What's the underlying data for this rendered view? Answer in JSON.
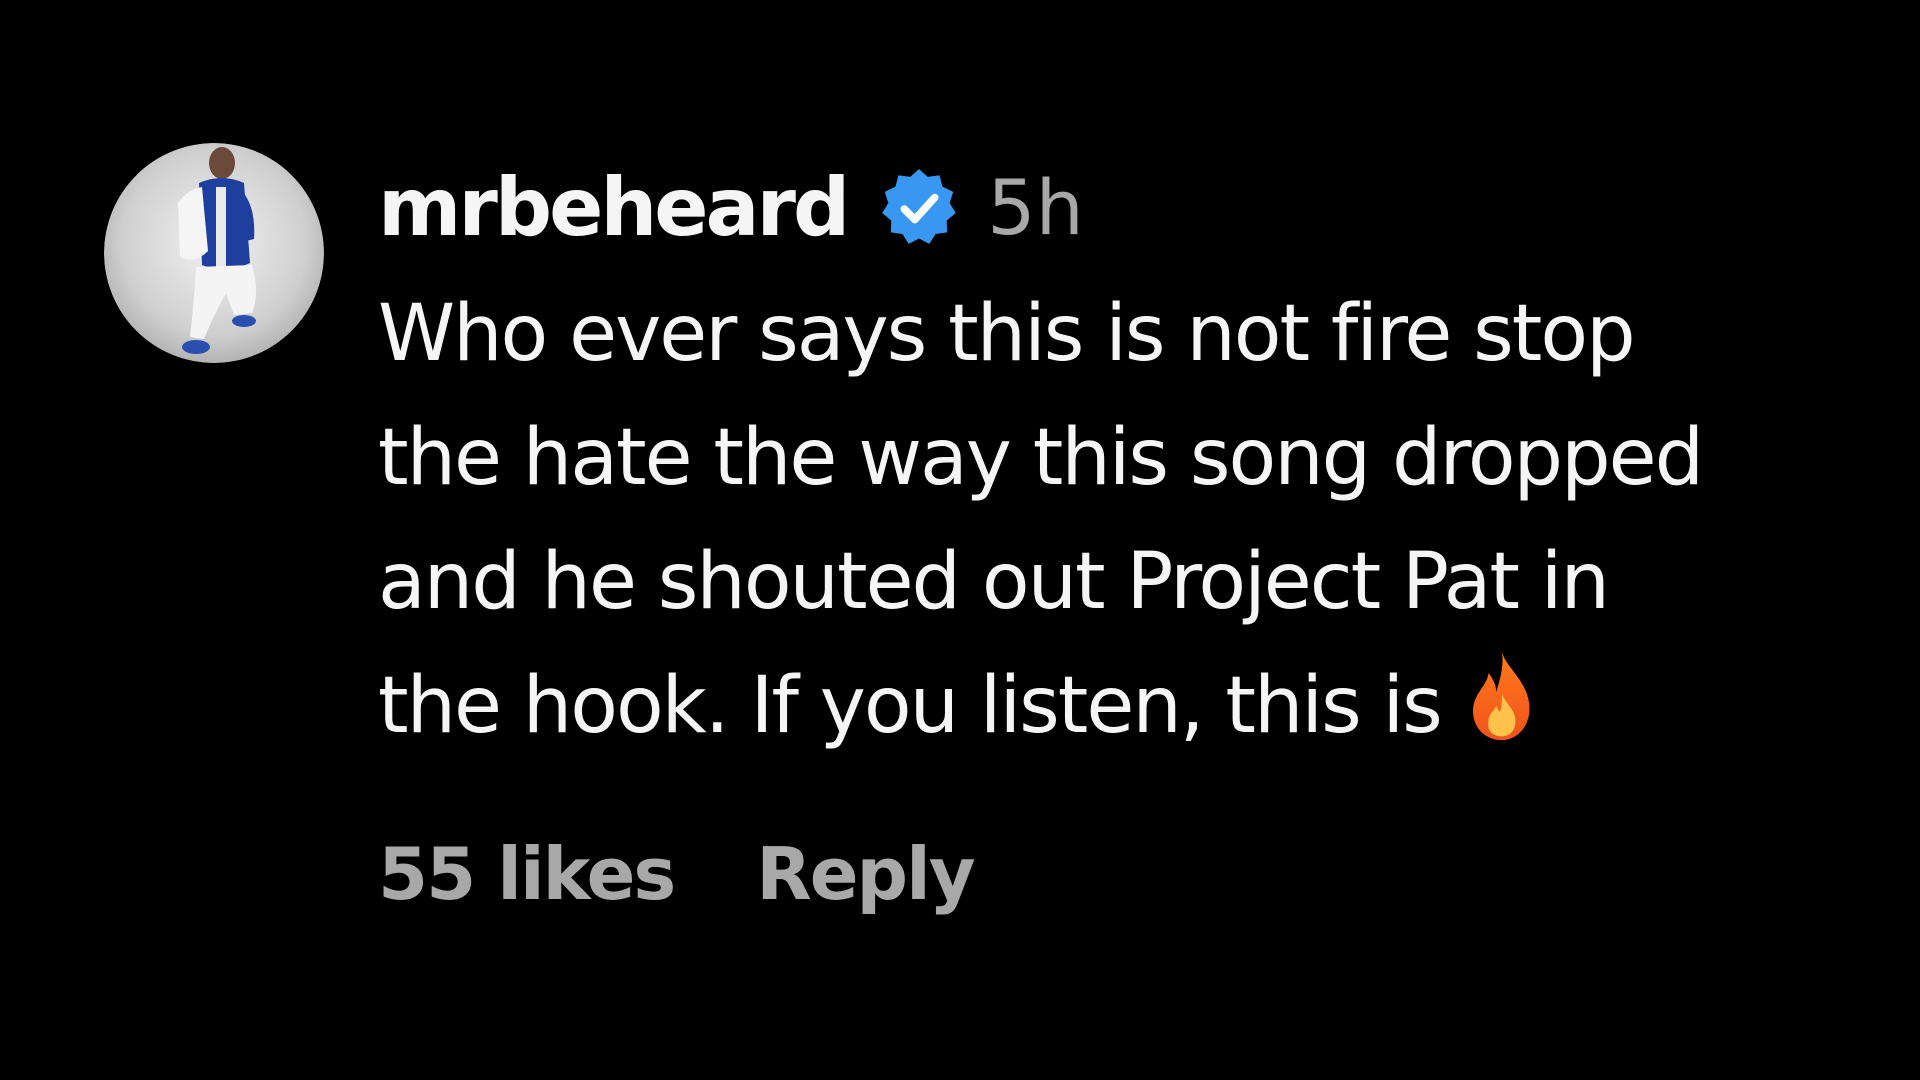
{
  "comment": {
    "author": {
      "username": "mrbeheard",
      "verified": true,
      "avatar_icon": "profile-photo"
    },
    "timestamp": "5h",
    "text_lines": [
      "Who ever says this is not fire stop",
      "the hate the way this song dropped",
      "and he shouted out Project Pat in",
      "the hook. If you listen, this is"
    ],
    "emoji": "fire-icon",
    "likes_label": "55 likes",
    "reply_label": "Reply"
  },
  "colors": {
    "background": "#000000",
    "primary_text": "#f5f5f5",
    "secondary_text": "#a8a8a8",
    "verified_badge": "#3897f0"
  }
}
